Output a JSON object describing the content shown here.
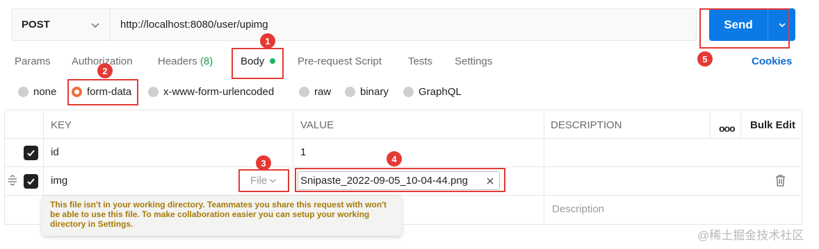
{
  "request": {
    "method": "POST",
    "url": "http://localhost:8080/user/upimg",
    "send_label": "Send"
  },
  "tabs": [
    {
      "label": "Params"
    },
    {
      "label": "Authorization"
    },
    {
      "label": "Headers",
      "count": "(8)"
    },
    {
      "label": "Body",
      "active": true
    },
    {
      "label": "Pre-request Script"
    },
    {
      "label": "Tests"
    },
    {
      "label": "Settings"
    }
  ],
  "cookies_label": "Cookies",
  "body_types": [
    {
      "label": "none"
    },
    {
      "label": "form-data",
      "selected": true
    },
    {
      "label": "x-www-form-urlencoded"
    },
    {
      "label": "raw"
    },
    {
      "label": "binary"
    },
    {
      "label": "GraphQL"
    }
  ],
  "table": {
    "headers": {
      "key": "KEY",
      "value": "VALUE",
      "description": "DESCRIPTION",
      "more": "ooo",
      "bulk_edit": "Bulk Edit"
    },
    "rows": [
      {
        "key": "id",
        "value": "1",
        "checked": true
      },
      {
        "key": "img",
        "type": "File",
        "file": "Snipaste_2022-09-05_10-04-44.png",
        "checked": true
      }
    ],
    "description_placeholder": "Description"
  },
  "tooltip": "This file isn't in your working directory. Teammates you share this request with won't be able to use this file. To make collaboration easier you can setup your working directory in Settings.",
  "annotations": [
    "1",
    "2",
    "3",
    "4",
    "5"
  ],
  "watermark": "@稀土掘金技术社区",
  "colors": {
    "send": "#0b7ae6",
    "annotation": "#e53935",
    "radio_selected": "#f26b3a",
    "body_dot": "#1fb45e",
    "warning_text": "#a87a07"
  }
}
